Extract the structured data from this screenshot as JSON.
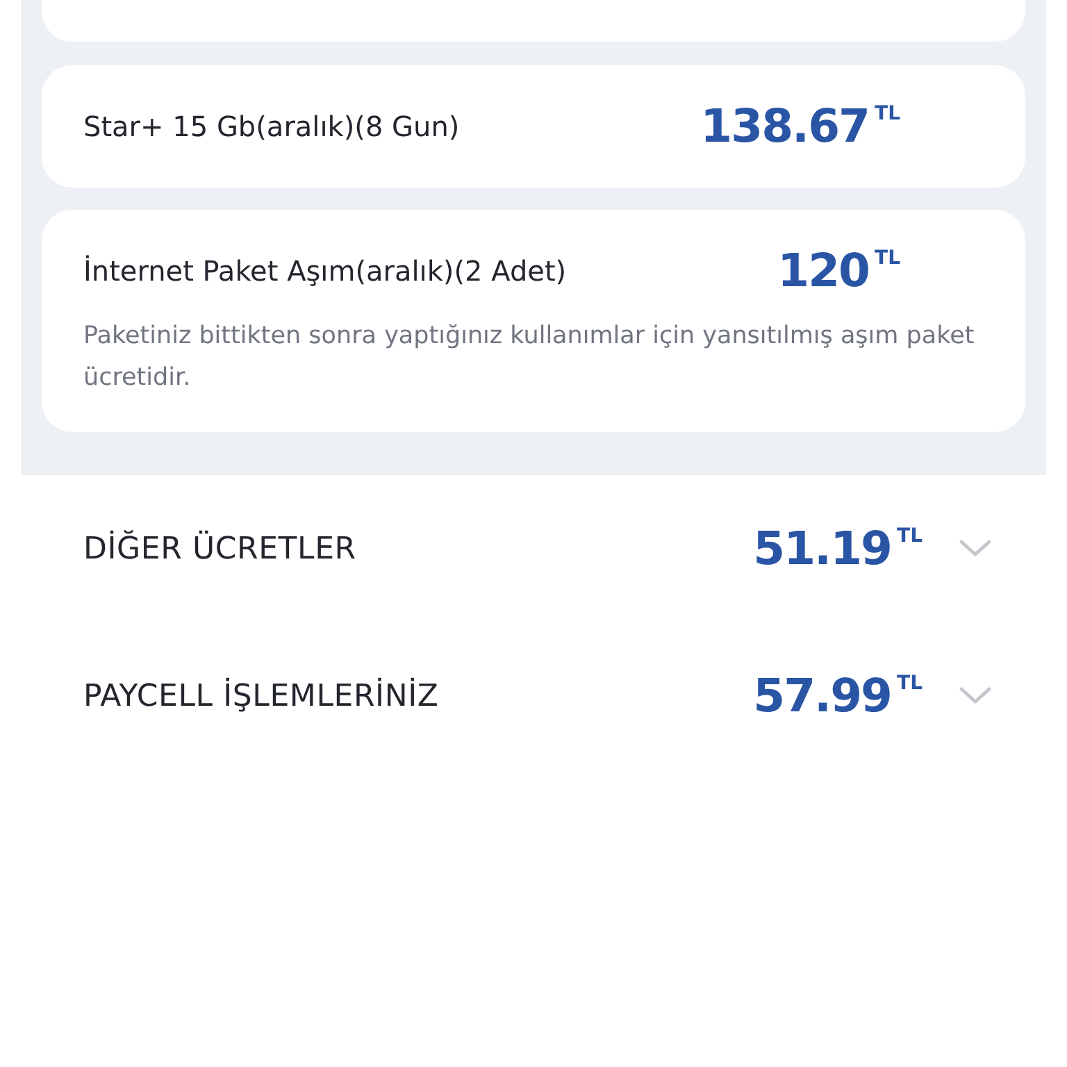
{
  "charges": [
    {
      "label": "Star+ 15 Gb(aralık)(8 Gun)",
      "amount": "138.67",
      "currency": "TL"
    },
    {
      "label": "İnternet Paket Aşım(aralık)(2 Adet)",
      "amount": "120",
      "currency": "TL",
      "description": "Paketiniz bittikten sonra yaptığınız kullanımlar için yansıtılmış aşım paket ücretidir."
    }
  ],
  "sections": [
    {
      "title": "DİĞER ÜCRETLER",
      "amount": "51.19",
      "currency": "TL",
      "expanded": false
    },
    {
      "title": "PAYCELL İŞLEMLERİNİZ",
      "amount": "57.99",
      "currency": "TL",
      "expanded": false
    }
  ]
}
